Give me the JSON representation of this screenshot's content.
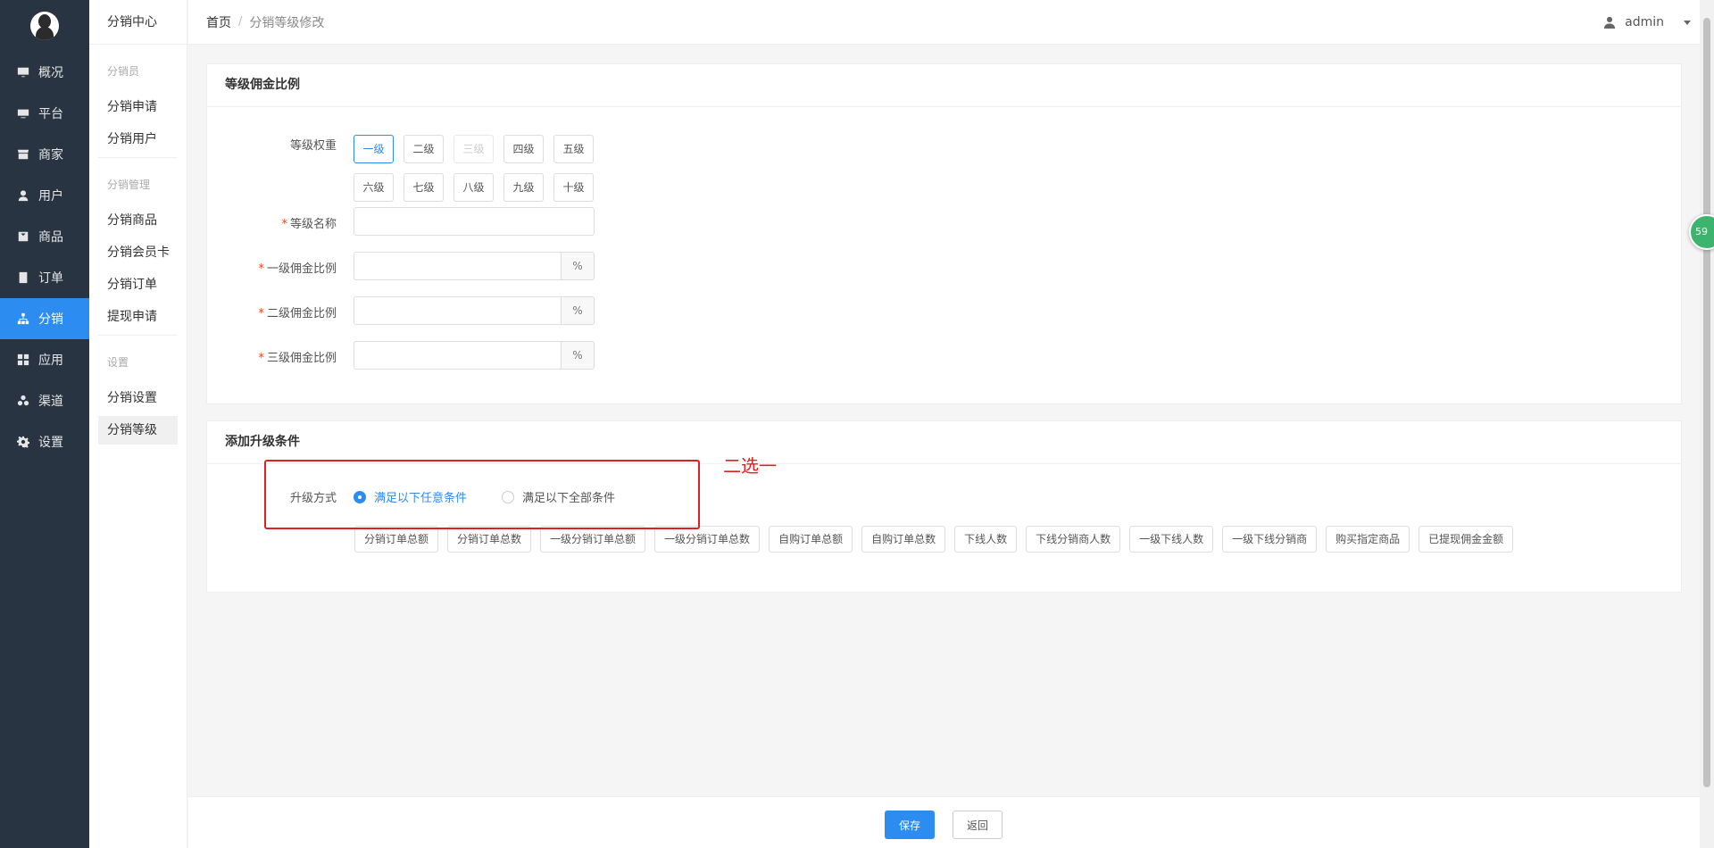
{
  "nav": {
    "items": [
      {
        "label": "概况",
        "icon": "monitor-icon"
      },
      {
        "label": "平台",
        "icon": "display-icon"
      },
      {
        "label": "商家",
        "icon": "store-icon"
      },
      {
        "label": "用户",
        "icon": "user-icon"
      },
      {
        "label": "商品",
        "icon": "goods-icon"
      },
      {
        "label": "订单",
        "icon": "order-icon"
      },
      {
        "label": "分销",
        "icon": "distribution-icon"
      },
      {
        "label": "应用",
        "icon": "apps-icon"
      },
      {
        "label": "渠道",
        "icon": "channel-icon"
      },
      {
        "label": "设置",
        "icon": "gear-icon"
      }
    ],
    "active_index": 6
  },
  "submenu": {
    "title": "分销中心",
    "groups": [
      {
        "heading": "分销员",
        "items": [
          "分销申请",
          "分销用户"
        ]
      },
      {
        "heading": "分销管理",
        "items": [
          "分销商品",
          "分销会员卡",
          "分销订单",
          "提现申请"
        ]
      },
      {
        "heading": "设置",
        "items": [
          "分销设置",
          "分销等级"
        ]
      }
    ],
    "active_item": "分销等级"
  },
  "breadcrumb": {
    "home": "首页",
    "separator": "/",
    "current": "分销等级修改"
  },
  "user": {
    "name": "admin"
  },
  "float_badge": "59",
  "card1": {
    "title": "等级佣金比例",
    "weight_label": "等级权重",
    "levels_row1": [
      "一级",
      "二级",
      "三级",
      "四级",
      "五级"
    ],
    "levels_row2": [
      "六级",
      "七级",
      "八级",
      "九级",
      "十级"
    ],
    "active_level": "一级",
    "disabled_level": "三级",
    "name_label": "等级名称",
    "name_value": "",
    "rate1_label": "一级佣金比例",
    "rate2_label": "二级佣金比例",
    "rate3_label": "三级佣金比例",
    "rate_unit": "%",
    "required_mark": "*"
  },
  "card2": {
    "title": "添加升级条件",
    "method_label": "升级方式",
    "option_any": "满足以下任意条件",
    "option_all": "满足以下全部条件",
    "selected_option": "any",
    "conditions": [
      "分销订单总额",
      "分销订单总数",
      "一级分销订单总额",
      "一级分销订单总数",
      "自购订单总额",
      "自购订单总数",
      "下线人数",
      "下线分销商人数",
      "一级下线人数",
      "一级下线分销商",
      "购买指定商品",
      "已提现佣金金额"
    ]
  },
  "annotation": {
    "note": "二选一",
    "color": "#e02020"
  },
  "footer": {
    "save": "保存",
    "back": "返回"
  },
  "colors": {
    "accent": "#2d8cf0",
    "nav_bg": "#283441"
  }
}
